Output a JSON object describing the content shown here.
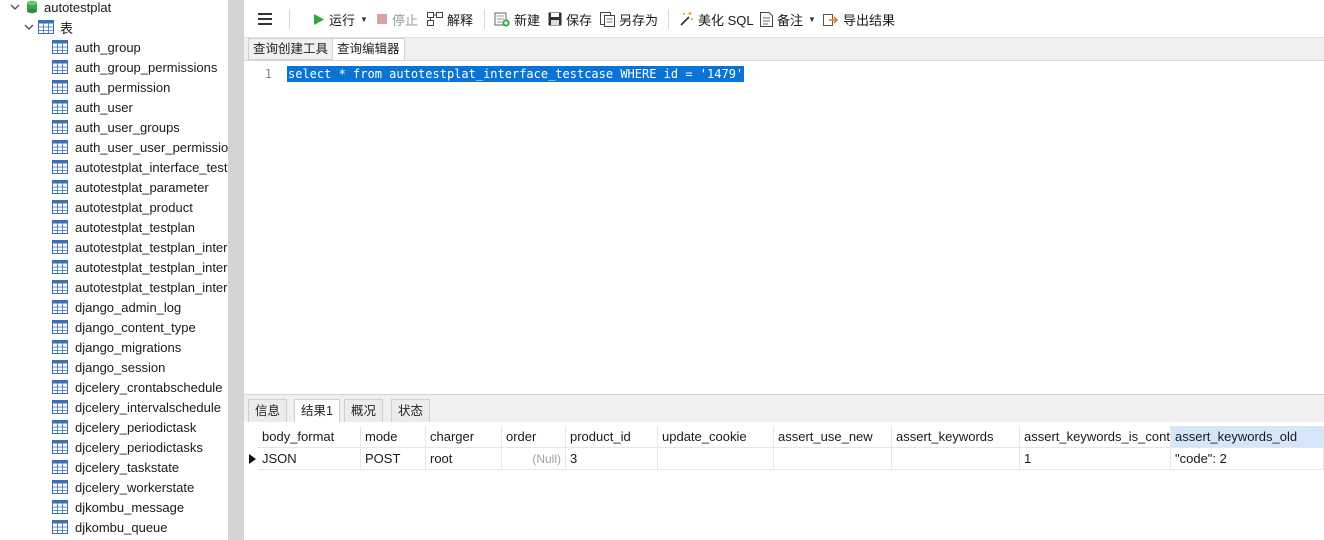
{
  "tree": {
    "database": "autotestplat",
    "tables_group": "表",
    "tables": [
      "auth_group",
      "auth_group_permissions",
      "auth_permission",
      "auth_user",
      "auth_user_groups",
      "auth_user_user_permission",
      "autotestplat_interface_test",
      "autotestplat_parameter",
      "autotestplat_product",
      "autotestplat_testplan",
      "autotestplat_testplan_inter",
      "autotestplat_testplan_inter",
      "autotestplat_testplan_inter",
      "django_admin_log",
      "django_content_type",
      "django_migrations",
      "django_session",
      "djcelery_crontabschedule",
      "djcelery_intervalschedule",
      "djcelery_periodictask",
      "djcelery_periodictasks",
      "djcelery_taskstate",
      "djcelery_workerstate",
      "djkombu_message",
      "djkombu_queue"
    ]
  },
  "toolbar": {
    "run": "运行",
    "stop": "停止",
    "explain": "解释",
    "new": "新建",
    "save": "保存",
    "save_as": "另存为",
    "beautify": "美化 SQL",
    "comment": "备注",
    "export": "导出结果"
  },
  "editor_tabs": [
    "查询创建工具",
    "查询编辑器"
  ],
  "editor": {
    "line_number": "1",
    "sql": "select * from autotestplat_interface_testcase WHERE id = '1479'"
  },
  "result_tabs": [
    "信息",
    "结果1",
    "概况",
    "状态"
  ],
  "grid": {
    "columns": [
      "body_format",
      "mode",
      "charger",
      "order",
      "product_id",
      "update_cookie",
      "assert_use_new",
      "assert_keywords",
      "assert_keywords_is_conta",
      "assert_keywords_old"
    ],
    "row": [
      "JSON",
      "POST",
      "root",
      "(Null)",
      "3",
      "",
      "",
      "",
      "1",
      "\"code\": 2"
    ]
  },
  "colors": {
    "selection": "#0a74d4",
    "selected_header": "#d6e6fa",
    "run_green": "#2fa83a",
    "splitter": "#d4d4d4"
  }
}
